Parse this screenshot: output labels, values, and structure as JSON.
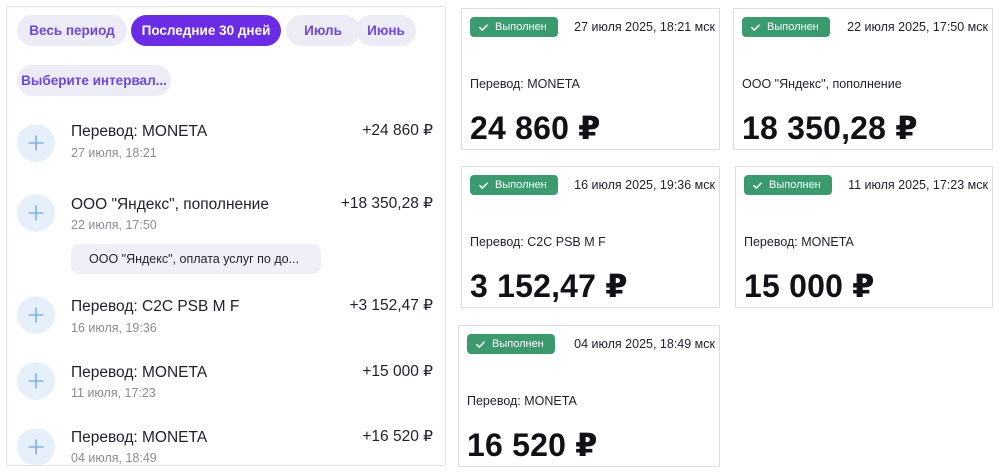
{
  "filters": [
    {
      "label": "Весь период",
      "active": false
    },
    {
      "label": "Последние 30 дней",
      "active": true
    },
    {
      "label": "Июль",
      "active": false
    },
    {
      "label": "Июнь",
      "active": false
    },
    {
      "label": "Выберите интервал...",
      "active": false
    }
  ],
  "transactions": [
    {
      "title": "Перевод: MONETA",
      "date": "27 июля, 18:21",
      "amount": "+24 860 ₽"
    },
    {
      "title": "ООО \"Яндекс\", пополнение",
      "date": "22 июля, 17:50",
      "amount": "+18 350,28 ₽",
      "note": "ООО \"Яндекс\", оплата услуг по до..."
    },
    {
      "title": "Перевод: C2C PSB M F",
      "date": "16 июля, 19:36",
      "amount": "+3 152,47 ₽"
    },
    {
      "title": "Перевод: MONETA",
      "date": "11 июля, 17:23",
      "amount": "+15 000 ₽"
    },
    {
      "title": "Перевод: MONETA",
      "date": "04 июля, 18:49",
      "amount": "+16 520 ₽"
    }
  ],
  "receipts": [
    {
      "status": "Выполнен",
      "datetime": "27 июля 2025, 18:21 мск",
      "description": "Перевод: MONETA",
      "amount": "24 860 ₽"
    },
    {
      "status": "Выполнен",
      "datetime": "22 июля 2025, 17:50 мск",
      "description": "ООО \"Яндекс\", пополнение",
      "amount": "18 350,28 ₽"
    },
    {
      "status": "Выполнен",
      "datetime": "16 июля 2025, 19:36 мск",
      "description": "Перевод: C2C PSB M F",
      "amount": "3 152,47 ₽"
    },
    {
      "status": "Выполнен",
      "datetime": "11 июля 2025, 17:23 мск",
      "description": "Перевод: MONETA",
      "amount": "15 000 ₽"
    },
    {
      "status": "Выполнен",
      "datetime": "04 июля 2025, 18:49 мск",
      "description": "Перевод: MONETA",
      "amount": "16 520 ₽"
    }
  ],
  "colors": {
    "accent": "#6b2ce6",
    "chip_bg": "#ecebf6",
    "chip_text": "#6e47d9",
    "status_green": "#3b9b6f",
    "plus_circle": "#e6f0fb",
    "plus_icon": "#7fb2e5"
  },
  "icons": {
    "transaction": "plus-icon",
    "status": "check-icon"
  }
}
